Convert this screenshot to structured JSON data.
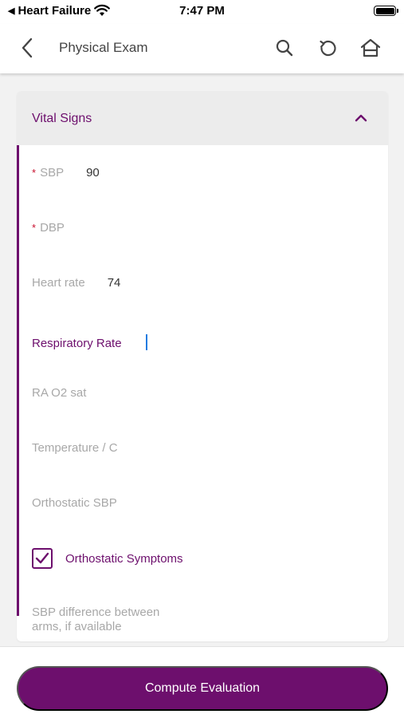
{
  "status_bar": {
    "back_app": "Heart Failure",
    "time": "7:47 PM"
  },
  "nav": {
    "title": "Physical Exam",
    "icons": [
      "back-chevron-icon",
      "search-icon",
      "reset-icon",
      "home-icon"
    ]
  },
  "section": {
    "title": "Vital Signs",
    "expanded": true,
    "fields": [
      {
        "label": "SBP",
        "required": true,
        "value": "90"
      },
      {
        "label": "DBP",
        "required": true,
        "value": ""
      },
      {
        "label": "Heart rate",
        "required": false,
        "value": "74"
      },
      {
        "label": "Respiratory Rate",
        "required": false,
        "value": "",
        "focused": true
      },
      {
        "label": "RA O2 sat",
        "required": false,
        "value": ""
      },
      {
        "label": "Temperature / C",
        "required": false,
        "value": ""
      },
      {
        "label": "Orthostatic SBP",
        "required": false,
        "value": ""
      }
    ],
    "checkbox": {
      "label": "Orthostatic Symptoms",
      "checked": true
    },
    "sbp_difference_label": "SBP difference between arms, if available"
  },
  "actions": {
    "compute_label": "Compute Evaluation"
  },
  "colors": {
    "accent": "#6d0f6d",
    "required": "#c8102e",
    "cursor": "#1e7be0"
  }
}
